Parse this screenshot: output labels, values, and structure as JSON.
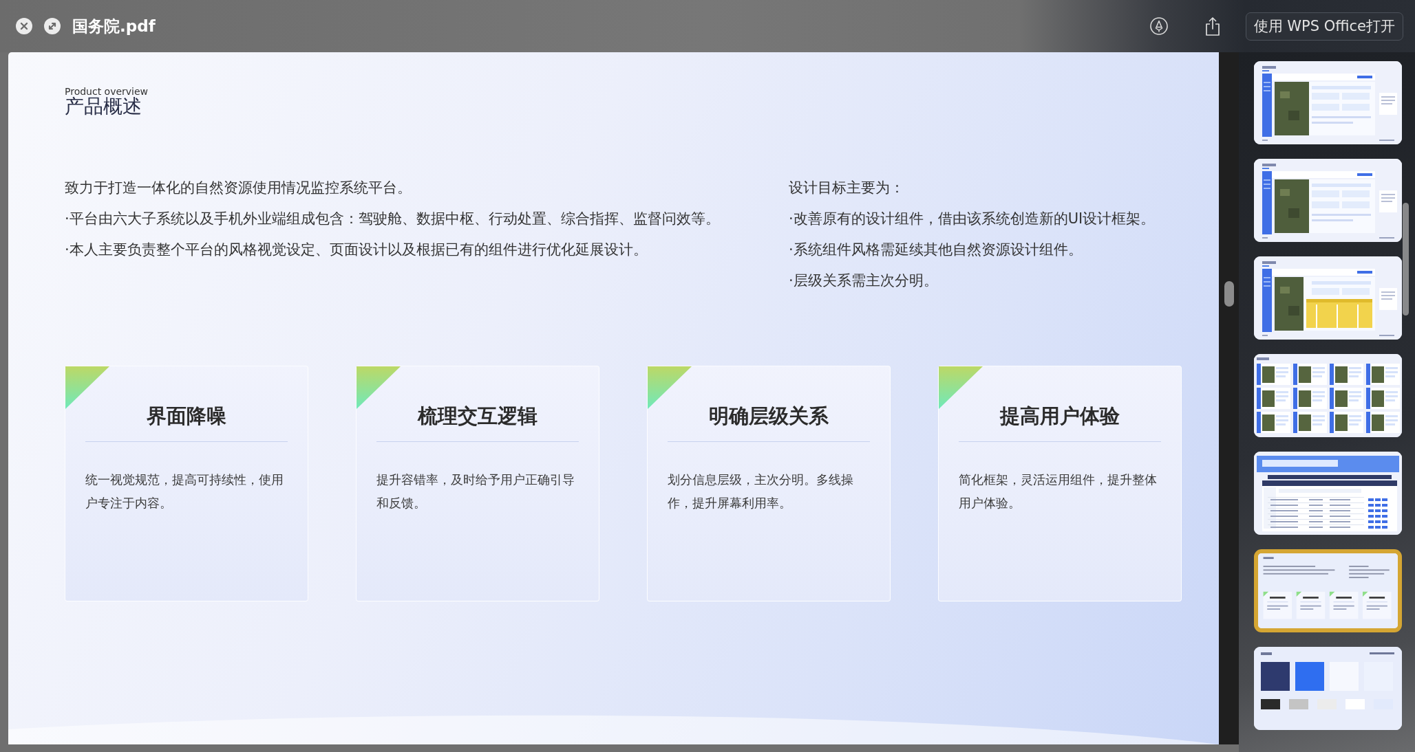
{
  "window": {
    "title": "国务院.pdf",
    "open_button": "使用 WPS Office打开"
  },
  "document": {
    "eyebrow": "Product overview",
    "heading": "产品概述",
    "intro": [
      "致力于打造一体化的自然资源使用情况监控系统平台。",
      "·平台由六大子系统以及手机外业端组成包含：驾驶舱、数据中枢、行动处置、综合指挥、监督问效等。",
      "·本人主要负责整个平台的风格视觉设定、页面设计以及根据已有的组件进行优化延展设计。"
    ],
    "goals": [
      "设计目标主要为：",
      "·改善原有的设计组件，借由该系统创造新的UI设计框架。",
      "·系统组件风格需延续其他自然资源设计组件。",
      "·层级关系需主次分明。"
    ],
    "cards": [
      {
        "title": "界面降噪",
        "body": "统一视觉规范，提高可持续性，使用户专注于内容。"
      },
      {
        "title": "梳理交互逻辑",
        "body": "提升容错率，及时给予用户正确引导和反馈。"
      },
      {
        "title": "明确层级关系",
        "body": "划分信息层级，主次分明。多线操作，提升屏幕利用率。"
      },
      {
        "title": "提高用户体验",
        "body": "简化框架，灵活运用组件，提升整体用户体验。"
      }
    ]
  },
  "thumbnails": [
    {
      "kind": "map",
      "selected": false
    },
    {
      "kind": "map",
      "selected": false
    },
    {
      "kind": "map-table",
      "selected": false
    },
    {
      "kind": "gallery",
      "selected": false
    },
    {
      "kind": "table",
      "selected": false
    },
    {
      "kind": "cards",
      "selected": true
    },
    {
      "kind": "swatches",
      "selected": false
    }
  ]
}
